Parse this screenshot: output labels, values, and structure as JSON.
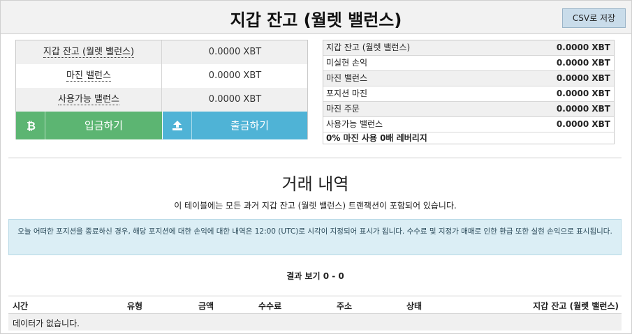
{
  "header": {
    "title": "지갑 잔고 (월렛 밸런스)",
    "csv_button": "CSV로 저장"
  },
  "balances": [
    {
      "label": "지갑 잔고 (월렛 밸런스)",
      "value": "0.0000 XBT"
    },
    {
      "label": "마진 밸런스",
      "value": "0.0000 XBT"
    },
    {
      "label": "사용가능 밸런스",
      "value": "0.0000 XBT"
    }
  ],
  "actions": {
    "deposit": {
      "label": "입금하기",
      "icon": "bitcoin-icon",
      "color": "#5cb572"
    },
    "withdraw": {
      "label": "출금하기",
      "icon": "upload-icon",
      "color": "#4fb3d6"
    }
  },
  "summary": {
    "rows": [
      {
        "label": "지갑 잔고 (월렛 밸런스)",
        "value": "0.0000 XBT"
      },
      {
        "label": "미실현 손익",
        "value": "0.0000 XBT"
      },
      {
        "label": "마진 밸런스",
        "value": "0.0000 XBT"
      },
      {
        "label": "포지션 마진",
        "value": "0.0000 XBT"
      },
      {
        "label": "마진 주문",
        "value": "0.0000 XBT"
      },
      {
        "label": "사용가능 밸런스",
        "value": "0.0000 XBT"
      }
    ],
    "footer": "0% 마진 사용 0배 레버리지"
  },
  "history": {
    "title": "거래 내역",
    "description": "이 테이블에는 모든 과거 지갑 잔고 (월렛 밸런스) 트랜잭션이 포함되어 있습니다.",
    "notice": "오늘 어떠한 포지션을 종료하신 경우, 해당 포지션에 대한 손익에 대한 내역은 12:00 (UTC)로 시각이 지정되어 표시가 됩니다. 수수료 및 지정가 매매로 인한 환급 또한 실현 손익으로 표시됩니다.",
    "results": "결과 보기 0 - 0",
    "columns": [
      "시간",
      "유형",
      "금액",
      "수수료",
      "주소",
      "상태",
      "지갑 잔고 (월렛 밸런스)"
    ],
    "empty": "데이터가 없습니다."
  }
}
